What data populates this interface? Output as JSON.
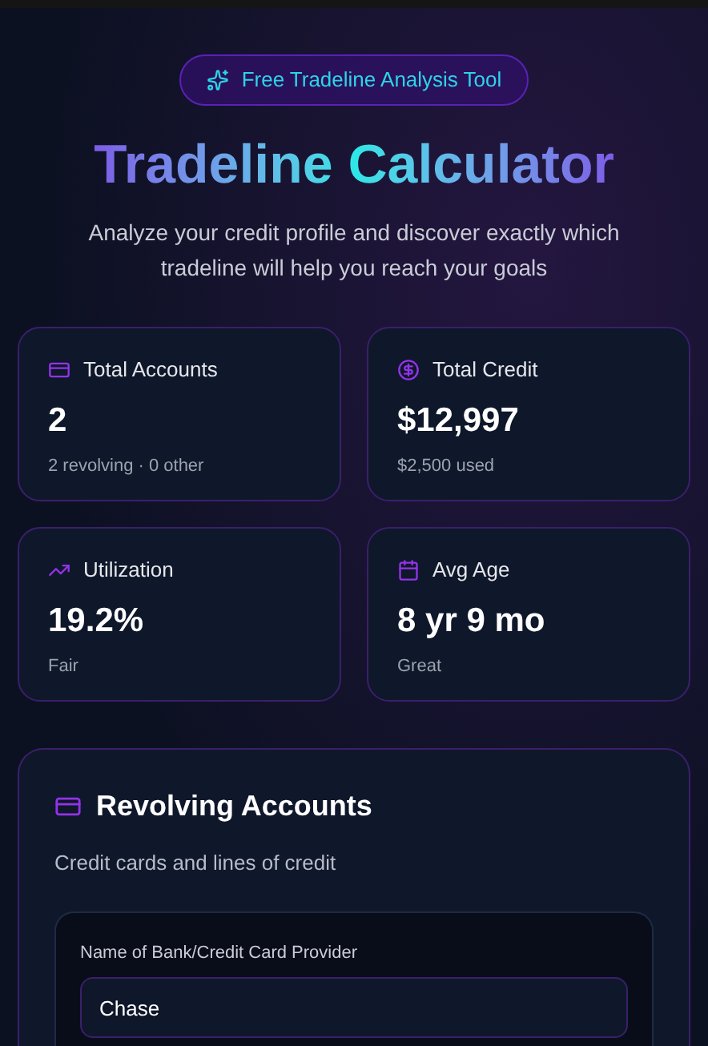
{
  "badge": {
    "label": "Free Tradeline Analysis Tool"
  },
  "title": "Tradeline Calculator",
  "subtitle": "Analyze your credit profile and discover exactly which tradeline will help you reach your goals",
  "stats": [
    {
      "kind": "card",
      "label": "Total Accounts",
      "value": "2",
      "note": "2 revolving · 0 other"
    },
    {
      "kind": "dollar",
      "label": "Total Credit",
      "value": "$12,997",
      "note": "$2,500 used"
    },
    {
      "kind": "trend",
      "label": "Utilization",
      "value": "19.2%",
      "note": "Fair"
    },
    {
      "kind": "calendar",
      "label": "Avg Age",
      "value": "8 yr 9 mo",
      "note": "Great"
    }
  ],
  "section": {
    "title": "Revolving Accounts",
    "subtitle": "Credit cards and lines of credit",
    "account": {
      "field_label": "Name of Bank/Credit Card Provider",
      "value": "Chase"
    }
  }
}
